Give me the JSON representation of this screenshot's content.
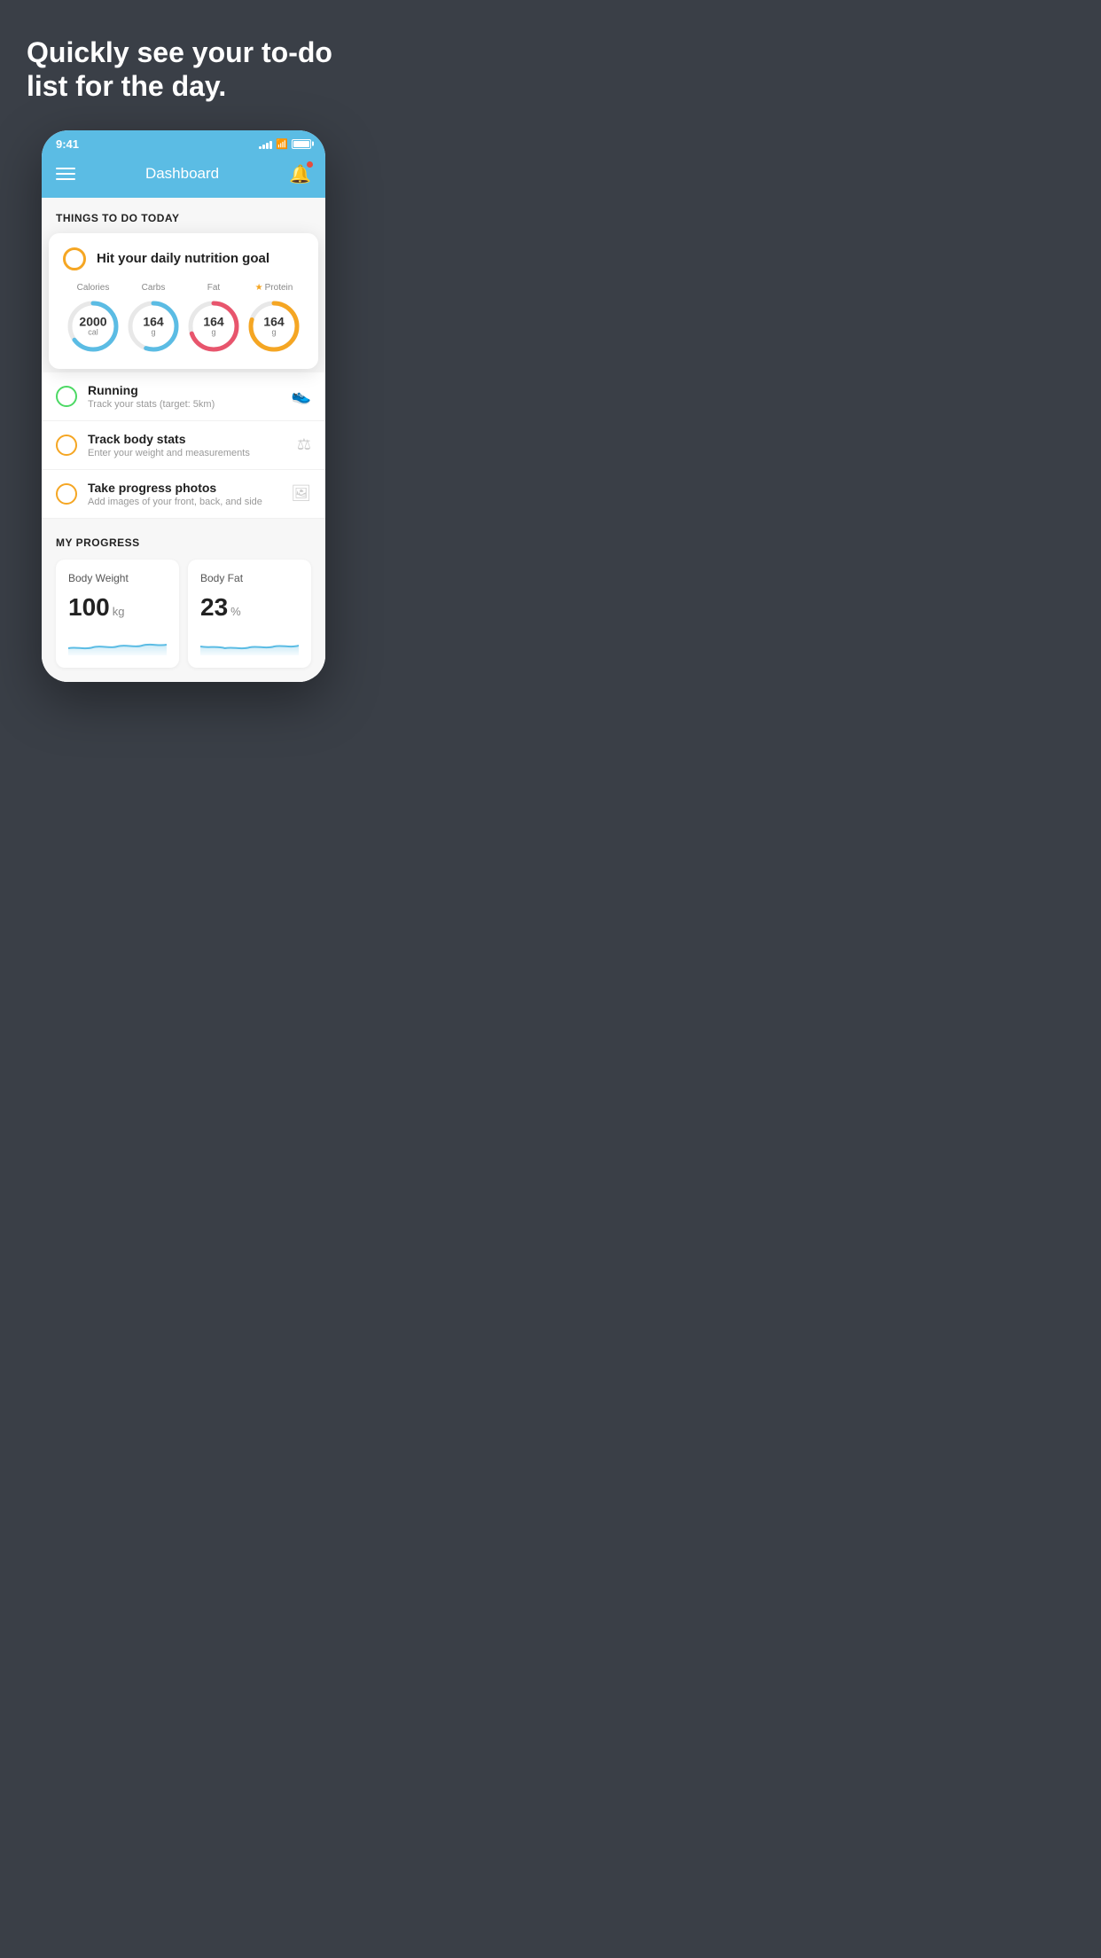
{
  "hero": {
    "text": "Quickly see your to-do list for the day."
  },
  "statusBar": {
    "time": "9:41",
    "signalBars": [
      3,
      5,
      7,
      9,
      11
    ],
    "batteryPercent": 85
  },
  "header": {
    "title": "Dashboard",
    "menuLabel": "menu",
    "bellLabel": "notifications"
  },
  "thingsToDo": {
    "sectionTitle": "THINGS TO DO TODAY",
    "nutritionCard": {
      "title": "Hit your daily nutrition goal",
      "macros": [
        {
          "label": "Calories",
          "value": "2000",
          "unit": "cal",
          "color": "#5bbce4",
          "percentage": 65
        },
        {
          "label": "Carbs",
          "value": "164",
          "unit": "g",
          "color": "#5bbce4",
          "percentage": 55
        },
        {
          "label": "Fat",
          "value": "164",
          "unit": "g",
          "color": "#e8556d",
          "percentage": 70
        },
        {
          "label": "Protein",
          "value": "164",
          "unit": "g",
          "color": "#f5a623",
          "percentage": 80,
          "starred": true
        }
      ]
    },
    "todoItems": [
      {
        "id": "running",
        "title": "Running",
        "subtitle": "Track your stats (target: 5km)",
        "circleColor": "green",
        "icon": "👟"
      },
      {
        "id": "body-stats",
        "title": "Track body stats",
        "subtitle": "Enter your weight and measurements",
        "circleColor": "yellow",
        "icon": "⚖"
      },
      {
        "id": "progress-photos",
        "title": "Take progress photos",
        "subtitle": "Add images of your front, back, and side",
        "circleColor": "yellow",
        "icon": "🖼"
      }
    ]
  },
  "progress": {
    "sectionTitle": "MY PROGRESS",
    "cards": [
      {
        "id": "body-weight",
        "title": "Body Weight",
        "value": "100",
        "unit": "kg"
      },
      {
        "id": "body-fat",
        "title": "Body Fat",
        "value": "23",
        "unit": "%"
      }
    ]
  }
}
